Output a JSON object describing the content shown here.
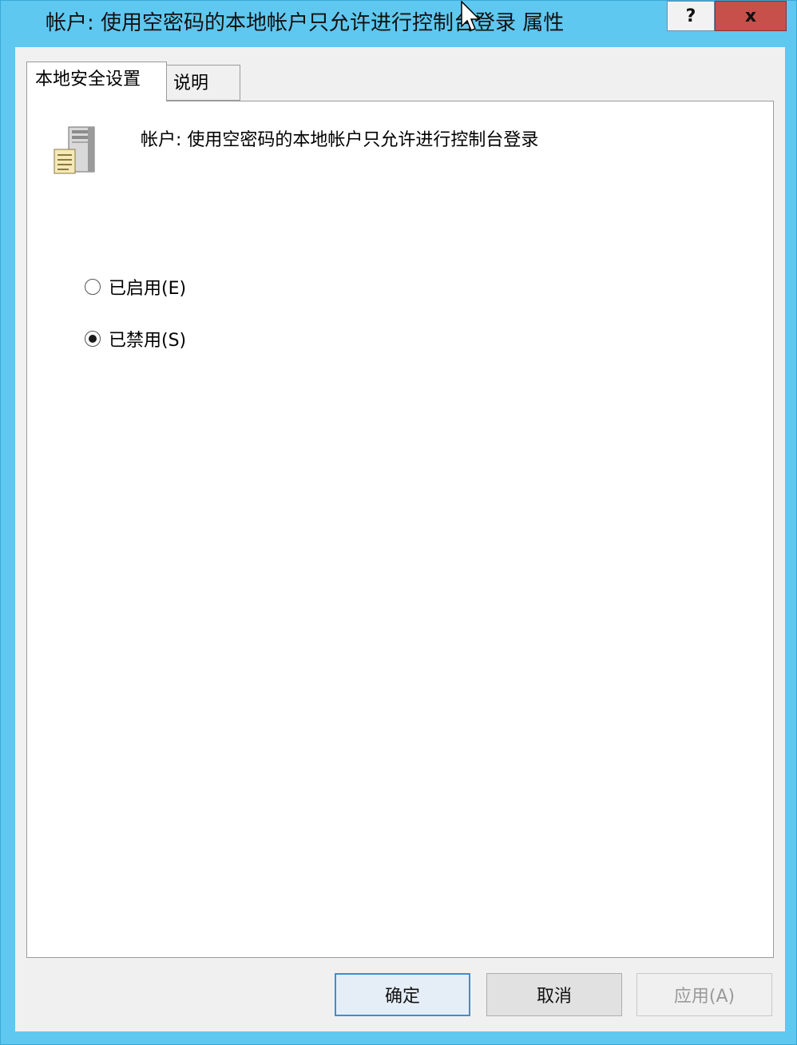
{
  "window": {
    "title": "帐户: 使用空密码的本地帐户只允许进行控制台登录 属性",
    "help_label": "?",
    "close_label": "x"
  },
  "tabs": [
    {
      "label": "本地安全设置",
      "active": true
    },
    {
      "label": "说明",
      "active": false
    }
  ],
  "policy": {
    "icon": "server-document-icon",
    "title": "帐户: 使用空密码的本地帐户只允许进行控制台登录"
  },
  "options": [
    {
      "label": "已启用(E)",
      "selected": false
    },
    {
      "label": "已禁用(S)",
      "selected": true
    }
  ],
  "buttons": {
    "ok": "确定",
    "cancel": "取消",
    "apply": "应用(A)",
    "apply_enabled": false
  },
  "colors": {
    "titlebar": "#5fc8f0",
    "close": "#c7504b",
    "focus": "#3c8fd4"
  }
}
